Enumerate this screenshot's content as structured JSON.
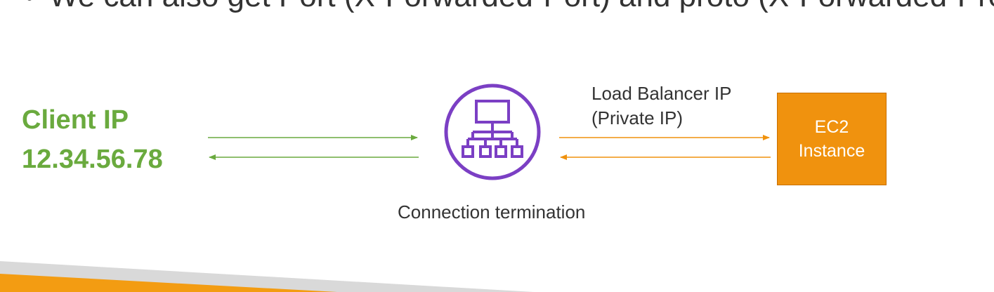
{
  "bullet": {
    "text": "We can also get Port (X-Forwarded-Port) and proto (X-Forwarded-Proto)"
  },
  "client": {
    "label": "Client IP",
    "ip": "12.34.56.78"
  },
  "load_balancer": {
    "icon": "application-load-balancer-icon",
    "caption": "Connection termination",
    "side_label_line1": "Load Balancer IP",
    "side_label_line2": "(Private IP)"
  },
  "ec2": {
    "line1": "EC2",
    "line2": "Instance"
  },
  "colors": {
    "client_green": "#6aaa3e",
    "orange": "#f0920e",
    "purple": "#7b3fc4",
    "footer_gray": "#d9d9d9"
  }
}
